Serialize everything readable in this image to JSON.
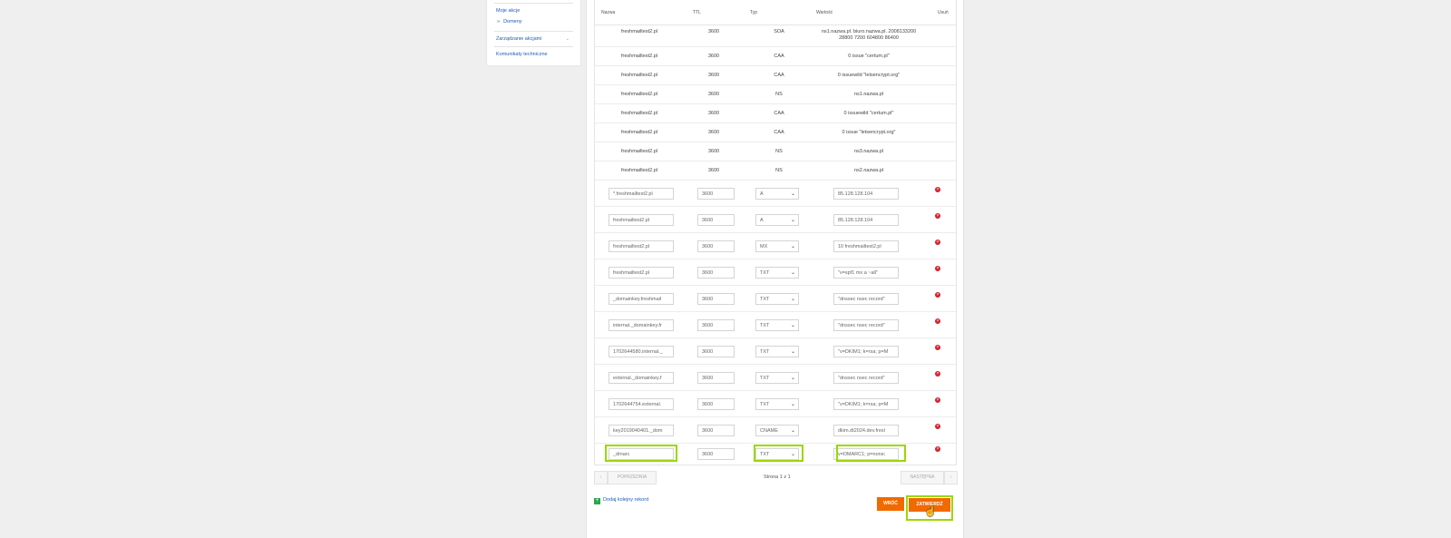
{
  "sidebar": {
    "items": [
      {
        "label": "Moje akcje"
      },
      {
        "label": "Domeny"
      },
      {
        "label": "Zarządzanie akcjami"
      },
      {
        "label": "Komunikaty techniczne"
      }
    ]
  },
  "table": {
    "headers": {
      "name": "Nazwa",
      "ttl": "TTL",
      "type": "Typ",
      "value": "Wartość",
      "delete": "Usuń"
    },
    "static_rows": [
      {
        "name": "freshmailtest2.pl",
        "ttl": "3600",
        "type": "SOA",
        "value_line1": "ns1.nazwa.pl. biuro.nazwa.pl. 2008133200",
        "value_line2": "28800 7200 604800 86400"
      },
      {
        "name": "freshmailtest2.pl",
        "ttl": "3600",
        "type": "CAA",
        "value_line1": "0 issue \"certum.pl\""
      },
      {
        "name": "freshmailtest2.pl",
        "ttl": "3600",
        "type": "CAA",
        "value_line1": "0 issuewild \"letsencrypt.org\""
      },
      {
        "name": "freshmailtest2.pl",
        "ttl": "3600",
        "type": "NS",
        "value_line1": "ns1.nazwa.pl"
      },
      {
        "name": "freshmailtest2.pl",
        "ttl": "3600",
        "type": "CAA",
        "value_line1": "0 issuewild \"certum.pl\""
      },
      {
        "name": "freshmailtest2.pl",
        "ttl": "3600",
        "type": "CAA",
        "value_line1": "0 issue \"letsencrypt.org\""
      },
      {
        "name": "freshmailtest2.pl",
        "ttl": "3600",
        "type": "NS",
        "value_line1": "ns3.nazwa.pl"
      },
      {
        "name": "freshmailtest2.pl",
        "ttl": "3600",
        "type": "NS",
        "value_line1": "ns2.nazwa.pl"
      }
    ],
    "edit_rows": [
      {
        "name": "*.freshmailtest2.pl",
        "ttl": "3600",
        "type": "A",
        "value": "85.128.128.104"
      },
      {
        "name": "freshmailtest2.pl",
        "ttl": "3600",
        "type": "A",
        "value": "85.128.128.104"
      },
      {
        "name": "freshmailtest2.pl",
        "ttl": "3600",
        "type": "MX",
        "value": "10 freshmailtest2.pl"
      },
      {
        "name": "freshmailtest2.pl",
        "ttl": "3600",
        "type": "TXT",
        "value": "\"v=spf1 mx a ~all\""
      },
      {
        "name": "_domainkey.freshmail",
        "ttl": "3600",
        "type": "TXT",
        "value": "\"dnssec nsec record\""
      },
      {
        "name": "internal._domainkey.fr",
        "ttl": "3600",
        "type": "TXT",
        "value": "\"dnssec nsec record\""
      },
      {
        "name": "1702644580.internal._",
        "ttl": "3600",
        "type": "TXT",
        "value": "\"v=DKIM1; k=rsa; p=M"
      },
      {
        "name": "external._domainkey.f",
        "ttl": "3600",
        "type": "TXT",
        "value": "\"dnssec nsec record\""
      },
      {
        "name": "1702644754.external.",
        "ttl": "3600",
        "type": "TXT",
        "value": "\"v=DKIM1; k=rsa; p=M"
      },
      {
        "name": "key2019040401._dom",
        "ttl": "3600",
        "type": "CNAME",
        "value": "dkim.dt2024.dev.fresl"
      },
      {
        "name": "_dmarc",
        "ttl": "3600",
        "type": "TXT",
        "value": "v=DMARC1; p=none;"
      }
    ]
  },
  "pagination": {
    "prev": "POPRZEDNIA",
    "next": "NASTĘPNA",
    "info": "Strona 1 z 1"
  },
  "actions": {
    "add_record": "Dodaj kolejny rekord",
    "back": "WRÓĆ",
    "confirm": "ZATWIERDŹ"
  },
  "colors": {
    "accent": "#f06a00",
    "highlight": "#9ad800",
    "link": "#1a5fb4",
    "delete": "#d6202b"
  }
}
